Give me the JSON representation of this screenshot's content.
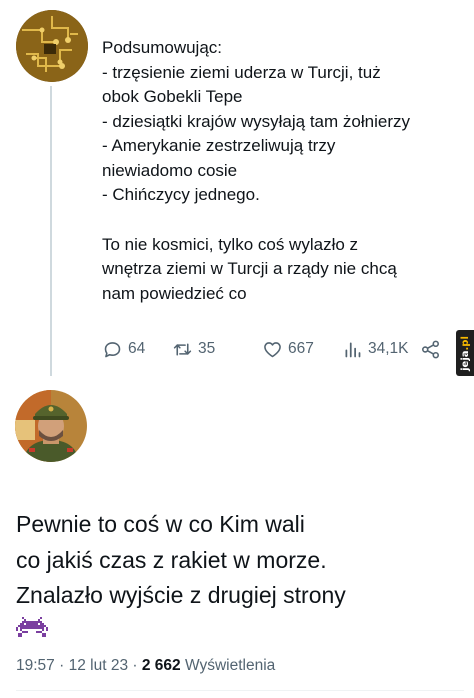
{
  "tweet1": {
    "lines": [
      "Podsumowując:",
      "- trzęsienie ziemi uderza w Turcji, tuż",
      "obok Gobekli Tepe",
      "- dziesiątki krajów wysyłają tam żołnierzy",
      "- Amerykanie zestrzeliwują trzy",
      "niewiadomo cosie",
      "- Chińczycy jednego."
    ],
    "lines2": [
      "To nie kosmici, tylko coś wylazło z",
      "wnętrza ziemi w Turcji a rządy nie chcą",
      "nam powiedzieć co"
    ],
    "actions": {
      "replies": "64",
      "retweets": "35",
      "likes": "667",
      "views": "34,1K"
    }
  },
  "tweet2": {
    "lines": [
      "Pewnie to coś w co Kim wali",
      "co jakiś czas z rakiet w morze.",
      "Znalazło wyjście z drugiej strony"
    ],
    "emoji": "alien-monster-emoji",
    "time": "19:57",
    "separator": "·",
    "date": "12 lut 23",
    "views_count": "2 662",
    "views_label": "Wyświetlenia"
  },
  "watermark": {
    "text_main": "jeja",
    "text_suffix": ".pl"
  },
  "colors": {
    "text": "#0f1419",
    "muted": "#536471",
    "thread_line": "#cfd9de",
    "emoji_purple": "#7b3fa0"
  }
}
